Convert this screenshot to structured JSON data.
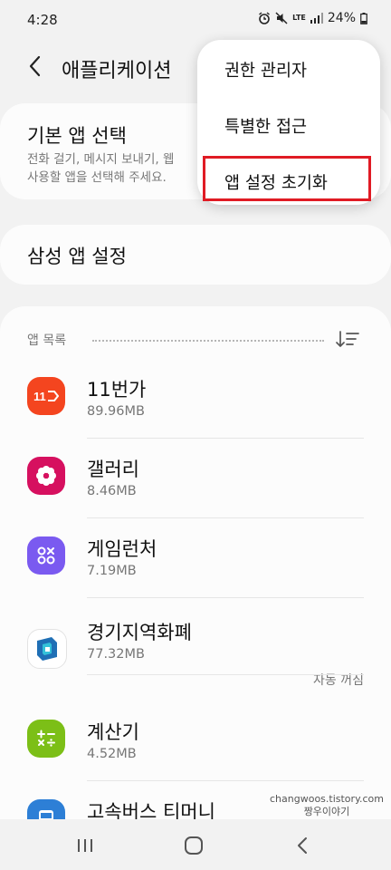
{
  "status_bar": {
    "time": "4:28",
    "network": "LTE",
    "battery": "24%"
  },
  "header": {
    "title": "애플리케이션"
  },
  "default_apps": {
    "title": "기본 앱 선택",
    "description": "전화 걸기, 메시지 보내기, 웹\n사용할 앱을 선택해 주세요."
  },
  "samsung_settings": {
    "title": "삼성 앱 설정"
  },
  "app_list": {
    "header": "앱 목록",
    "apps": [
      {
        "name": "11번가",
        "size": "89.96MB",
        "status": "",
        "icon_color": "#f4451f"
      },
      {
        "name": "갤러리",
        "size": "8.46MB",
        "status": "",
        "icon_color": "#d6105f"
      },
      {
        "name": "게임런처",
        "size": "7.19MB",
        "status": "",
        "icon_color": "#7a5af0"
      },
      {
        "name": "경기지역화폐",
        "size": "77.32MB",
        "status": "자동 꺼짐",
        "icon_color": "#1f6fb5"
      },
      {
        "name": "계산기",
        "size": "4.52MB",
        "status": "",
        "icon_color": "#7cbf17"
      },
      {
        "name": "고속버스 티머니",
        "size": "",
        "status": "",
        "icon_color": "#2d7fd6"
      }
    ]
  },
  "popup_menu": {
    "items": [
      "권한 관리자",
      "특별한 접근",
      "앱 설정 초기화"
    ],
    "highlight_color": "#e01b24"
  },
  "watermark": {
    "line1": "changwoos.tistory.com",
    "line2": "짱우이야기"
  }
}
